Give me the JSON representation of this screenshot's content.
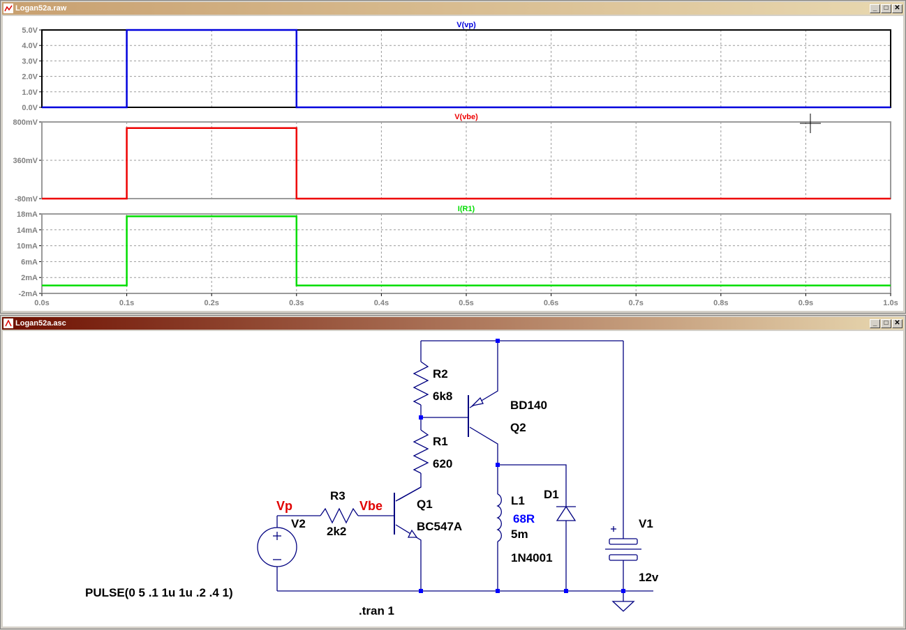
{
  "windows": {
    "waveform": {
      "title": "Logan52a.raw",
      "bar_from": "#c8a070",
      "bar_to": "#e8d8b0"
    },
    "schematic": {
      "title": "Logan52a.asc",
      "bar_from": "#6e0f00",
      "bar_to": "#e8d8b0"
    }
  },
  "window_buttons": {
    "minimize": "_",
    "restore": "□",
    "close": "✕"
  },
  "plot": {
    "x_ticks": [
      "0.0s",
      "0.1s",
      "0.2s",
      "0.3s",
      "0.4s",
      "0.5s",
      "0.6s",
      "0.7s",
      "0.8s",
      "0.9s",
      "1.0s"
    ],
    "panes": [
      {
        "name": "V(vp)",
        "color": "#0000dd",
        "frame": "#000000",
        "ticks": [
          "5.0V",
          "4.0V",
          "3.0V",
          "2.0V",
          "1.0V",
          "0.0V"
        ],
        "ylim": [
          0,
          5
        ],
        "trace": {
          "low": 0,
          "high": 5,
          "rise": 0.1,
          "fall": 0.3
        }
      },
      {
        "name": "V(vbe)",
        "color": "#ee0000",
        "frame": "#9a9a9a",
        "ticks": [
          "800mV",
          "360mV",
          "-80mV"
        ],
        "ylim": [
          -80,
          800
        ],
        "trace": {
          "low": -80,
          "high": 730,
          "rise": 0.1,
          "fall": 0.3
        }
      },
      {
        "name": "I(R1)",
        "color": "#00dd00",
        "frame": "#9a9a9a",
        "ticks": [
          "18mA",
          "14mA",
          "10mA",
          "6mA",
          "2mA",
          "-2mA"
        ],
        "ylim": [
          -2,
          18
        ],
        "trace": {
          "low": 0,
          "high": 17.4,
          "rise": 0.1,
          "fall": 0.3
        }
      }
    ],
    "xlim": [
      0,
      1.0
    ]
  },
  "schematic": {
    "labels": {
      "r2_name": "R2",
      "r2_value": "6k8",
      "r1_name": "R1",
      "r1_value": "620",
      "r3_name": "R3",
      "r3_value": "2k2",
      "q2_model": "BD140",
      "q2_name": "Q2",
      "q1_name": "Q1",
      "q1_model": "BC547A",
      "l1_name": "L1",
      "l1_res": "68R",
      "l1_value": "5m",
      "l1_extra": "1N4001",
      "d1_name": "D1",
      "v1_name": "V1",
      "v1_value": "12v",
      "v2_name": "V2",
      "net_vp": "Vp",
      "net_vbe": "Vbe",
      "pulse": "PULSE(0 5 .1 1u 1u .2 .4 1)",
      "tran": ".tran 1"
    },
    "colors": {
      "wire": "#000080",
      "component": "#000080",
      "net_label": "#e00000",
      "node": "#0000ff",
      "res_highlight": "#0000ff"
    }
  }
}
